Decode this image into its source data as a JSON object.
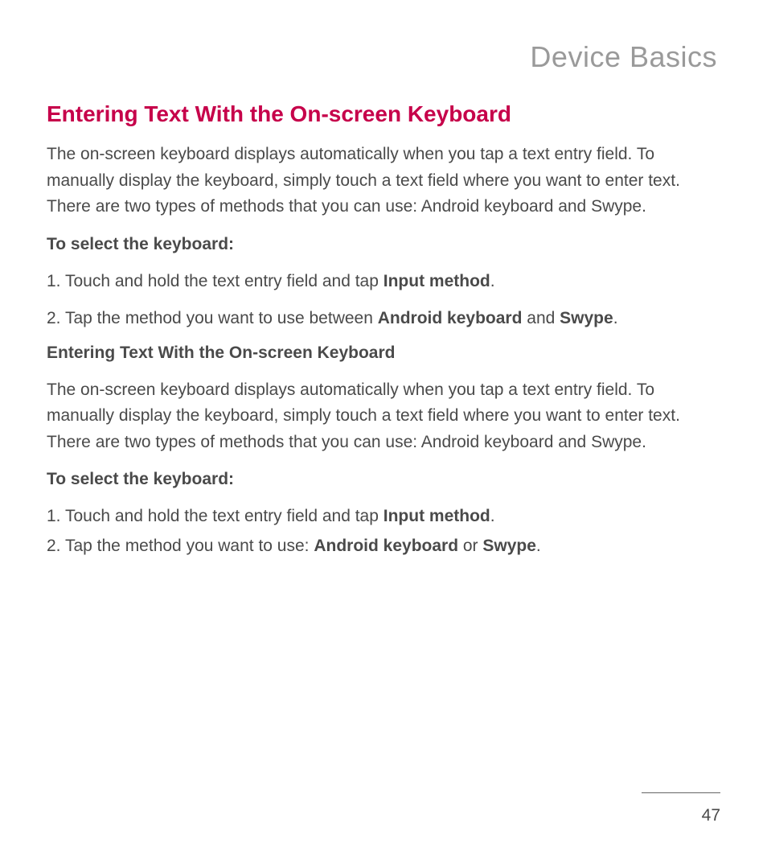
{
  "header": "Device Basics",
  "section_title": "Entering Text With the On-screen Keyboard",
  "intro1": "The on-screen keyboard displays automatically when you tap a text entry field. To manually display the keyboard, simply touch a text field where you want to enter text. There are two types of methods that you can use: Android keyboard and Swype.",
  "select_heading1": "To select the keyboard:",
  "step1a_pre": "1. Touch and hold the text entry field and tap ",
  "step1a_bold": "Input method",
  "step1a_post": ".",
  "step2a_pre": "2. Tap the method you want to use between ",
  "step2a_bold1": "Android keyboard",
  "step2a_mid": " and ",
  "step2a_bold2": "Swype",
  "step2a_post": ".",
  "subhead2": "Entering Text With the On-screen Keyboard",
  "intro2": "The on-screen keyboard displays automatically when you tap a text entry field. To manually display the keyboard, simply touch a text field where you want to enter text. There are two types of methods that you can use: Android keyboard and Swype.",
  "select_heading2": "To select the keyboard:",
  "step1b_pre": "1. Touch and hold the text entry field and tap ",
  "step1b_bold": "Input method",
  "step1b_post": ".",
  "step2b_pre": "2. Tap the method you want to use: ",
  "step2b_bold1": "Android keyboard",
  "step2b_mid": " or ",
  "step2b_bold2": "Swype",
  "step2b_post": ".",
  "page_number": "47"
}
